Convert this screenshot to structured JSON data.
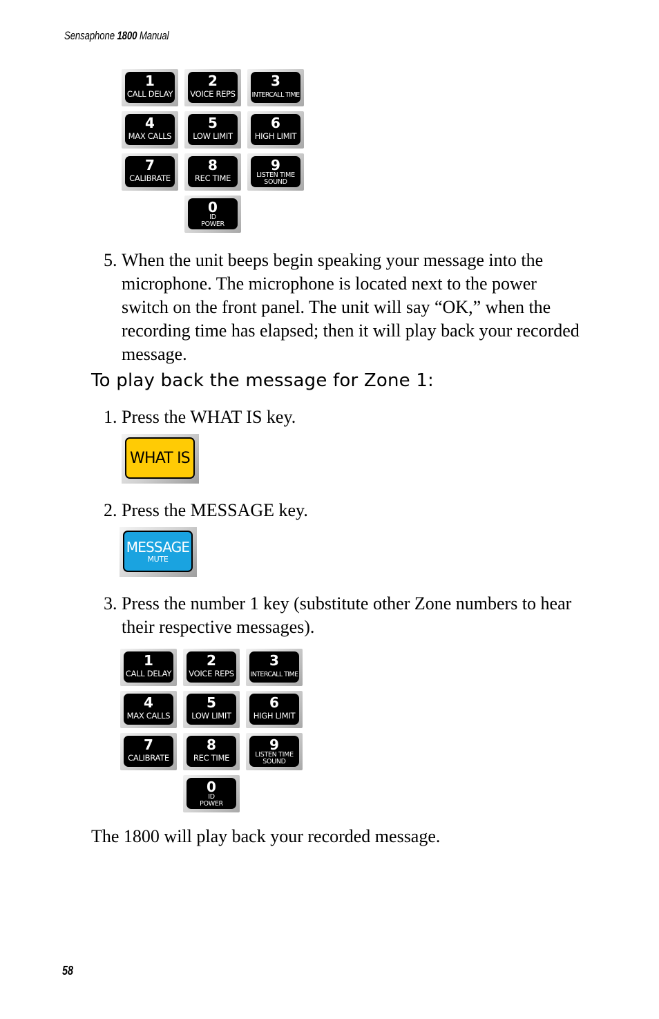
{
  "header": {
    "title_pre": "Sensaphone ",
    "title_bold": "1800",
    "title_post": " Manual"
  },
  "keypad_keys": [
    {
      "digit": "1",
      "label": "CALL DELAY"
    },
    {
      "digit": "2",
      "label": "VOICE REPS"
    },
    {
      "digit": "3",
      "label": "INTERCALL TIME"
    },
    {
      "digit": "4",
      "label": "MAX CALLS"
    },
    {
      "digit": "5",
      "label": "LOW LIMIT"
    },
    {
      "digit": "6",
      "label": "HIGH LIMIT"
    },
    {
      "digit": "7",
      "label": "CALIBRATE"
    },
    {
      "digit": "8",
      "label": "REC TIME"
    },
    {
      "digit": "9",
      "label": "LISTEN TIME",
      "label2": "SOUND"
    },
    {
      "digit": "0",
      "label": "ID",
      "label2": "POWER"
    }
  ],
  "step5": {
    "num": "5.",
    "lines": [
      "When the unit beeps begin speaking your message into the",
      "microphone.  The microphone is located next to the power",
      "switch on the front panel.  The unit will say “OK,” when the",
      "recording time has elapsed; then it will play back your recorded",
      "message."
    ]
  },
  "section_heading": "To play back the message for Zone 1:",
  "playback_steps": [
    {
      "num": "1.",
      "lines": [
        "Press the WHAT IS key."
      ]
    },
    {
      "num": "2.",
      "lines": [
        "Press the MESSAGE key."
      ]
    },
    {
      "num": "3.",
      "lines": [
        "Press the number 1 key (substitute other Zone numbers to hear",
        "their respective messages)."
      ]
    }
  ],
  "what_is_key": {
    "label": "WHAT IS",
    "color": "#ffcb05"
  },
  "message_key": {
    "label": "MESSAGE",
    "sublabel": "MUTE",
    "color": "#1aa3e0"
  },
  "closing_text": "The 1800 will play back your recorded message.",
  "page_number": "58"
}
